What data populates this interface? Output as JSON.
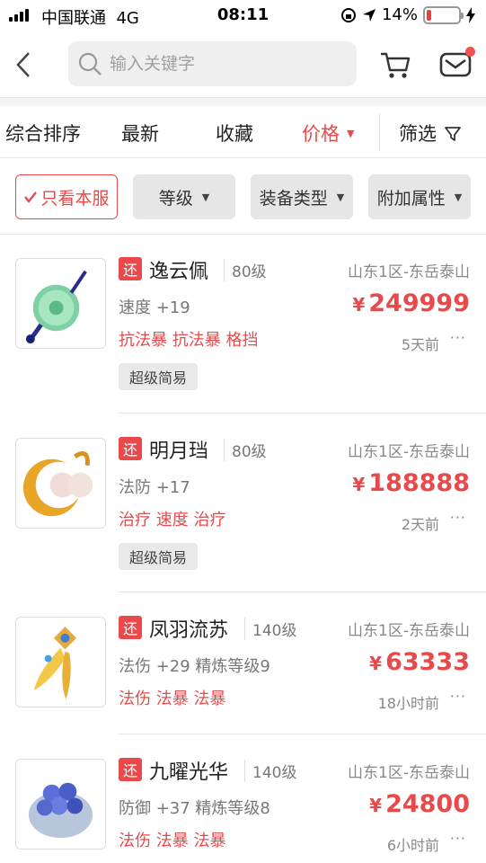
{
  "status": {
    "carrier": "中国联通",
    "network": "4G",
    "time": "08:11",
    "battery_percent": "14%",
    "battery_level": 0.14
  },
  "search": {
    "placeholder": "输入关键字"
  },
  "sort_tabs": [
    {
      "label": "综合排序"
    },
    {
      "label": "最新"
    },
    {
      "label": "收藏"
    },
    {
      "label": "价格"
    },
    {
      "label": "筛选"
    }
  ],
  "filters": {
    "server_only": "只看本服",
    "level": "等级",
    "equip_type": "装备类型",
    "extra_attr": "附加属性"
  },
  "return_badge": "还",
  "items": [
    {
      "name": "逸云佩",
      "level": "80级",
      "server": "山东1区-东岳泰山",
      "stats": "速度 +19",
      "currency": "¥",
      "price": "249999",
      "attrs": "抗法暴 抗法暴 格挡",
      "time": "5天前",
      "tag": "超级简易"
    },
    {
      "name": "明月珰",
      "level": "80级",
      "server": "山东1区-东岳泰山",
      "stats": "法防 +17",
      "currency": "¥",
      "price": "188888",
      "attrs": "治疗 速度 治疗",
      "time": "2天前",
      "tag": "超级简易"
    },
    {
      "name": "凤羽流苏",
      "level": "140级",
      "server": "山东1区-东岳泰山",
      "stats": "法伤 +29 精炼等级9",
      "currency": "¥",
      "price": "63333",
      "attrs": "法伤 法暴 法暴",
      "time": "18小时前",
      "tag": ""
    },
    {
      "name": "九曜光华",
      "level": "140级",
      "server": "山东1区-东岳泰山",
      "stats": "防御 +37 精炼等级8",
      "currency": "¥",
      "price": "24800",
      "attrs": "法伤 法暴 法暴",
      "time": "6小时前",
      "tag": ""
    }
  ],
  "more_label": "···",
  "colors": {
    "accent": "#e8494a",
    "chip_bg": "#e9e9e9"
  }
}
